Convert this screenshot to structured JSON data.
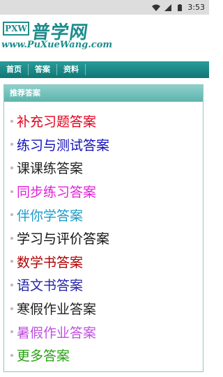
{
  "status_bar": {
    "time": "3:53",
    "icons": [
      "wifi-icon",
      "signal-icon",
      "battery-icon"
    ]
  },
  "logo": {
    "box_text": "PXW",
    "title": "普学网",
    "url": "www.PuXueWang.com"
  },
  "nav": {
    "items": [
      {
        "label": "首页"
      },
      {
        "label": "答案"
      },
      {
        "label": "资料"
      }
    ]
  },
  "panel": {
    "header": "推荐答案",
    "links": [
      {
        "label": "补充习题答案",
        "color": "#e0001c"
      },
      {
        "label": "练习与测试答案",
        "color": "#1010b8"
      },
      {
        "label": "课课练答案",
        "color": "#222222"
      },
      {
        "label": "同步练习答案",
        "color": "#e020d8"
      },
      {
        "label": "伴你学答案",
        "color": "#1a9bc8"
      },
      {
        "label": "学习与评价答案",
        "color": "#111111"
      },
      {
        "label": "数学书答案",
        "color": "#b00000"
      },
      {
        "label": "语文书答案",
        "color": "#2424a8"
      },
      {
        "label": "寒假作业答案",
        "color": "#222222"
      },
      {
        "label": "暑假作业答案",
        "color": "#c050e0"
      },
      {
        "label": "更多答案",
        "color": "#28a014"
      }
    ]
  }
}
